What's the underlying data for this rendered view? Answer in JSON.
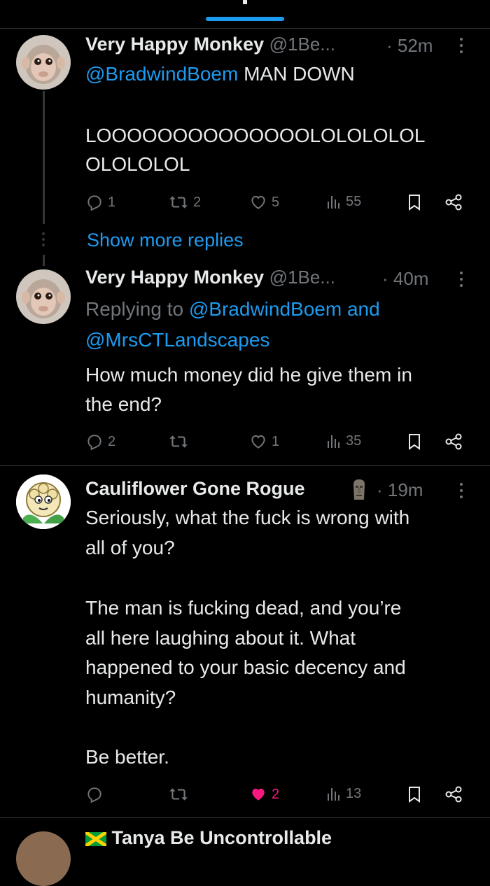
{
  "tweets": [
    {
      "name": "Very Happy Monkey",
      "handle": "@1Be...",
      "time": "· 52m",
      "mention": "@BradwindBoem",
      "text_1": "MAN DOWN",
      "text_2": "LOOOOOOOOOOOOOOLOLOLOLOL",
      "text_3": "OLOLOLOL",
      "replies": "1",
      "reposts": "2",
      "likes": "5",
      "views": "55"
    },
    {
      "name": "Very Happy Monkey",
      "handle": "@1Be...",
      "time": "· 40m",
      "replying_prefix": "Replying to",
      "replying_to_1": "@BradwindBoem",
      "replying_and": "and",
      "replying_to_2": "@MrsCTLandscapes",
      "text_1": "How much money did he give them in",
      "text_2": "the end?",
      "replies": "2",
      "reposts": "",
      "likes": "1",
      "views": "35"
    },
    {
      "name": "Cauliflower Gone Rogue",
      "time": "· 19m",
      "text_1": "Seriously, what the fuck is wrong with",
      "text_2": "all of you?",
      "text_3": "The man is fucking dead, and you’re",
      "text_4": "all here laughing about it. What",
      "text_5": "happened to your basic decency and",
      "text_6": "humanity?",
      "text_7": "Be better.",
      "replies": "",
      "reposts": "",
      "likes": "2",
      "views": "13"
    }
  ],
  "show_more_label": "Show more replies",
  "next_name_peek": "Tanya Be Uncontrollable",
  "colors": {
    "accent": "#1d9bf0",
    "like": "#f91880",
    "text": "#e7e9ea",
    "muted": "#71767b"
  },
  "icons": [
    "reply-icon",
    "repost-icon",
    "heart-icon",
    "views-icon",
    "bookmark-icon",
    "share-icon",
    "more-icon",
    "moai-icon",
    "flag-icon"
  ]
}
